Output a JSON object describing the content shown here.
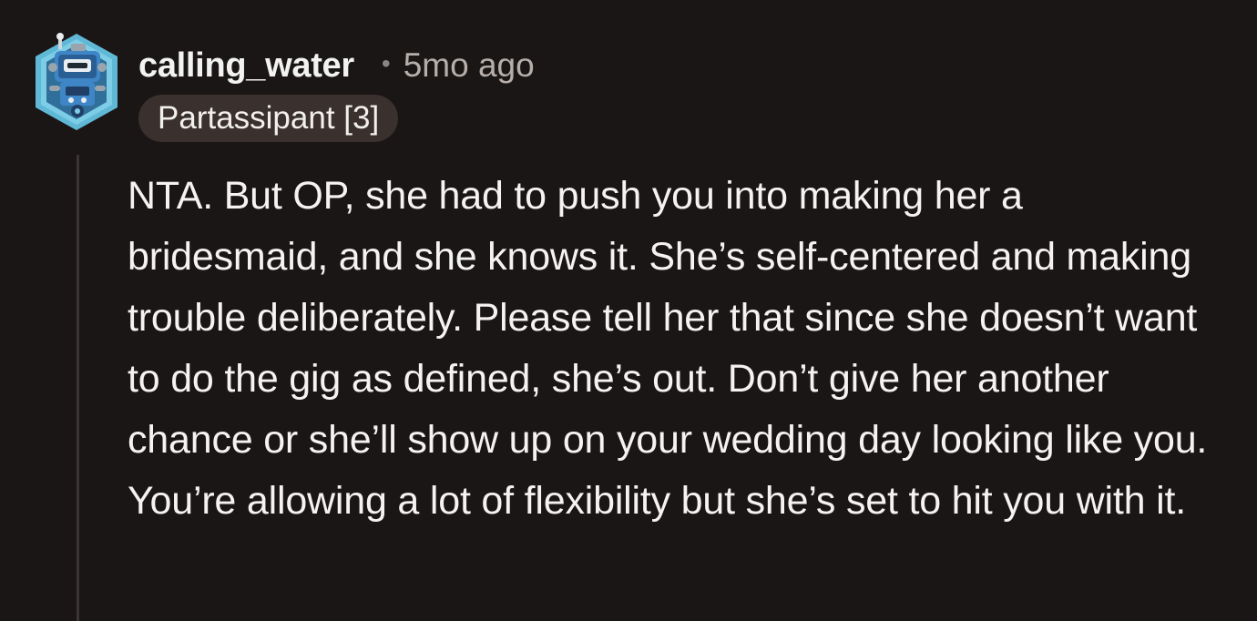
{
  "comment": {
    "username": "calling_water",
    "separator": "•",
    "timestamp": "5mo ago",
    "flair": "Partassipant [3]",
    "body": "NTA. But OP, she had to push you into making her a bridesmaid, and she knows it. She’s self-centered and making trouble deliberately. Please tell her that since she doesn’t want to do the gig as defined, she’s out. Don’t give her another chance or she’ll show up on your wedding day looking like you. You’re allowing a lot of flexibility but she’s set to hit you with it."
  },
  "colors": {
    "background": "#1a1615",
    "flair_background": "#3a302d",
    "text": "#f4f2f2",
    "muted_text": "#b5aeab",
    "avatar_frame": "#5fb8d6"
  },
  "icons": {
    "avatar": "robot-avatar-icon"
  }
}
